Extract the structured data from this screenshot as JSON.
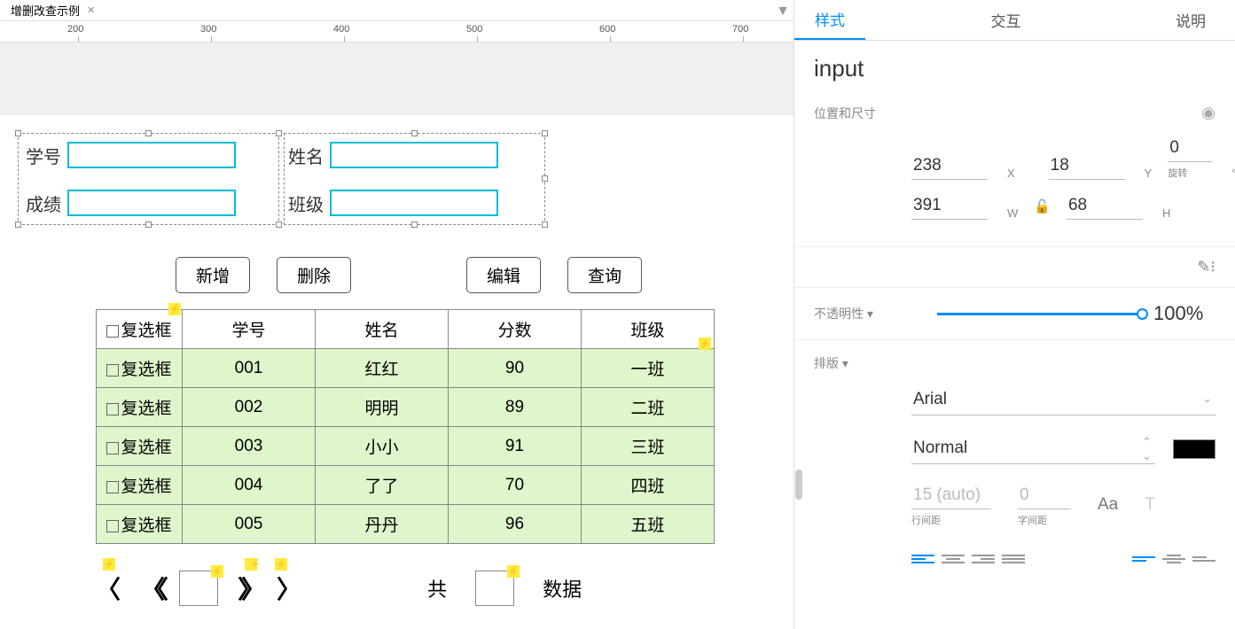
{
  "tab": {
    "title": "增删改查示例"
  },
  "ruler": {
    "ticks": [
      200,
      300,
      400,
      500,
      600,
      700
    ]
  },
  "form": {
    "labels": {
      "id": "学号",
      "name": "姓名",
      "score": "成绩",
      "class": "班级"
    }
  },
  "buttons": {
    "add": "新增",
    "del": "删除",
    "edit": "编辑",
    "query": "查询"
  },
  "table": {
    "headers": {
      "cb": "复选框",
      "id": "学号",
      "name": "姓名",
      "score": "分数",
      "class": "班级"
    },
    "cb_label": "复选框",
    "rows": [
      {
        "id": "001",
        "name": "红红",
        "score": "90",
        "class": "一班"
      },
      {
        "id": "002",
        "name": "明明",
        "score": "89",
        "class": "二班"
      },
      {
        "id": "003",
        "name": "小小",
        "score": "91",
        "class": "三班"
      },
      {
        "id": "004",
        "name": "了了",
        "score": "70",
        "class": "四班"
      },
      {
        "id": "005",
        "name": "丹丹",
        "score": "96",
        "class": "五班"
      }
    ]
  },
  "pagination": {
    "total_label": "共",
    "data_label": "数据"
  },
  "inspector": {
    "tabs": {
      "style": "样式",
      "interact": "交互",
      "note": "说明"
    },
    "title": "input",
    "pos_size_label": "位置和尺寸",
    "x": "238",
    "x_label": "X",
    "y": "18",
    "y_label": "Y",
    "rot": "0",
    "rot_unit": "°",
    "rot_label": "旋转",
    "w": "391",
    "w_label": "W",
    "h": "68",
    "h_label": "H",
    "opacity_label": "不透明性",
    "opacity": "100%",
    "typography_label": "排版",
    "font": "Arial",
    "weight": "Normal",
    "line_height": "15 (auto)",
    "line_height_label": "行间距",
    "letter_spacing": "0",
    "letter_spacing_label": "字间距",
    "aa_icon": "Aa"
  }
}
